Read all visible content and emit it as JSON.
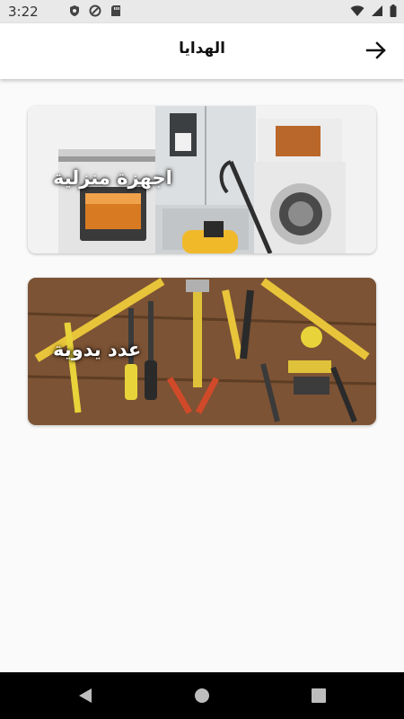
{
  "status_bar": {
    "time": "3:22",
    "left_icons": [
      "shield-icon",
      "sync-icon",
      "sd-card-icon"
    ],
    "right_icons": [
      "wifi-icon",
      "signal-icon",
      "battery-icon"
    ]
  },
  "app_bar": {
    "title": "الهدايا",
    "nav_icon": "arrow-right-icon"
  },
  "categories": [
    {
      "label": "اجهزة منزلية",
      "image": "home-appliances-photo"
    },
    {
      "label": "عدد يدوية",
      "image": "hand-tools-photo"
    }
  ],
  "nav_bar": {
    "buttons": [
      "back-triangle-icon",
      "home-circle-icon",
      "recents-square-icon"
    ]
  },
  "colors": {
    "background": "#fafafa",
    "app_bar": "#ffffff",
    "nav_bar": "#000000",
    "status_bar": "#e9e9e9"
  }
}
